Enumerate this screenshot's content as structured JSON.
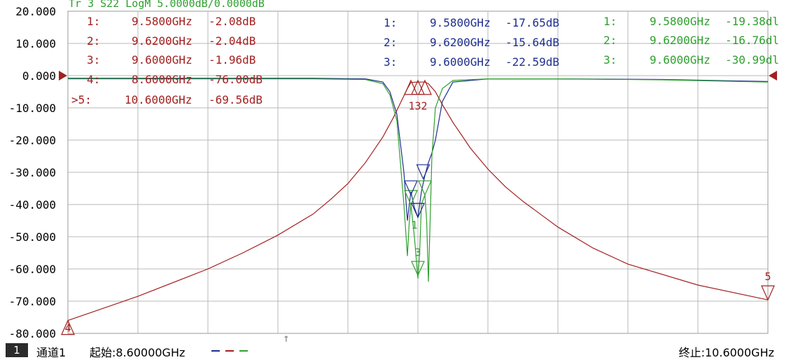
{
  "header": {
    "trace_title": "Tr 3  S22 LogM 5.0000dB/0.0000dB"
  },
  "colors": {
    "trace_red": "#a32020",
    "trace_blue": "#1f2f8f",
    "trace_green": "#2f9f2f",
    "grid": "#b8b8b8"
  },
  "markers": {
    "red": [
      {
        "label": "1:",
        "freq": "9.5800GHz",
        "value": "-2.08dB"
      },
      {
        "label": "2:",
        "freq": "9.6200GHz",
        "value": "-2.04dB"
      },
      {
        "label": "3:",
        "freq": "9.6000GHz",
        "value": "-1.96dB"
      },
      {
        "label": "4:",
        "freq": "8.6000GHz",
        "value": "-76.00dB"
      },
      {
        "label": ">5:",
        "freq": "10.6000GHz",
        "value": "-69.56dB"
      }
    ],
    "blue": [
      {
        "label": "1:",
        "freq": "9.5800GHz",
        "value": "-17.65dB"
      },
      {
        "label": "2:",
        "freq": "9.6200GHz",
        "value": "-15.64dB"
      },
      {
        "label": "3:",
        "freq": "9.6000GHz",
        "value": "-22.59dB"
      }
    ],
    "green": [
      {
        "label": "1:",
        "freq": "9.5800GHz",
        "value": "-19.38dl"
      },
      {
        "label": "2:",
        "freq": "9.6200GHz",
        "value": "-16.76dl"
      },
      {
        "label": "3:",
        "freq": "9.6000GHz",
        "value": "-30.99dl"
      }
    ]
  },
  "marker_tags": {
    "red_center": "132",
    "red_left": "4",
    "red_right": "5",
    "green_dip": "3",
    "blue_dip": "1"
  },
  "status": {
    "channel_num": "1",
    "channel_label": "通道1",
    "start_label": "起始:8.60000GHz",
    "stop_label": "终止:10.6000GHz"
  },
  "chart_data": {
    "type": "line",
    "xlabel": "",
    "ylabel": "",
    "xlim": [
      8.6,
      10.6
    ],
    "ylim": [
      -80,
      20
    ],
    "yticks": [
      "20.000",
      "10.000",
      "0.000",
      "-10.000",
      "-20.000",
      "-30.000",
      "-40.000",
      "-50.000",
      "-60.000",
      "-70.000",
      "-80.000"
    ],
    "grid": true,
    "series": [
      {
        "color": "#a32020",
        "x": [
          8.6,
          8.8,
          9.0,
          9.1,
          9.2,
          9.3,
          9.35,
          9.4,
          9.45,
          9.5,
          9.53,
          9.55,
          9.57,
          9.58,
          9.6,
          9.62,
          9.63,
          9.65,
          9.67,
          9.7,
          9.75,
          9.8,
          9.85,
          9.9,
          10.0,
          10.1,
          10.2,
          10.4,
          10.6
        ],
        "y": [
          -76.0,
          -68.5,
          -60.0,
          -55.0,
          -49.5,
          -43.0,
          -38.5,
          -33.5,
          -27.0,
          -19.0,
          -13.0,
          -8.5,
          -4.0,
          -2.1,
          -2.0,
          -2.0,
          -2.5,
          -5.0,
          -9.0,
          -14.5,
          -22.5,
          -29.0,
          -34.5,
          -39.0,
          -47.0,
          -53.5,
          -58.5,
          -65.0,
          -69.6
        ]
      },
      {
        "color": "#1f2f8f",
        "x": [
          8.6,
          9.0,
          9.3,
          9.45,
          9.5,
          9.52,
          9.54,
          9.56,
          9.57,
          9.58,
          9.59,
          9.6,
          9.61,
          9.62,
          9.63,
          9.64,
          9.65,
          9.67,
          9.7,
          9.8,
          10.0,
          10.3,
          10.6
        ],
        "y": [
          -0.8,
          -0.8,
          -0.8,
          -1.0,
          -2.0,
          -5.0,
          -12.0,
          -30.0,
          -45.0,
          -36.0,
          -41.0,
          -44.0,
          -36.0,
          -31.0,
          -27.0,
          -24.0,
          -20.0,
          -8.0,
          -2.0,
          -1.0,
          -1.0,
          -1.2,
          -1.8
        ]
      },
      {
        "color": "#2f9f2f",
        "x": [
          8.6,
          9.0,
          9.3,
          9.45,
          9.5,
          9.52,
          9.54,
          9.56,
          9.57,
          9.575,
          9.58,
          9.59,
          9.6,
          9.605,
          9.61,
          9.62,
          9.625,
          9.63,
          9.635,
          9.64,
          9.65,
          9.67,
          9.7,
          9.8,
          10.0,
          10.3,
          10.6
        ],
        "y": [
          -1.0,
          -1.0,
          -1.0,
          -1.2,
          -2.5,
          -6.0,
          -14.0,
          -40.0,
          -56.0,
          -46.0,
          -40.0,
          -50.0,
          -63.0,
          -55.0,
          -40.0,
          -37.0,
          -45.0,
          -64.0,
          -45.0,
          -25.0,
          -10.0,
          -4.0,
          -1.5,
          -1.0,
          -1.0,
          -1.3,
          -2.0
        ]
      }
    ]
  }
}
